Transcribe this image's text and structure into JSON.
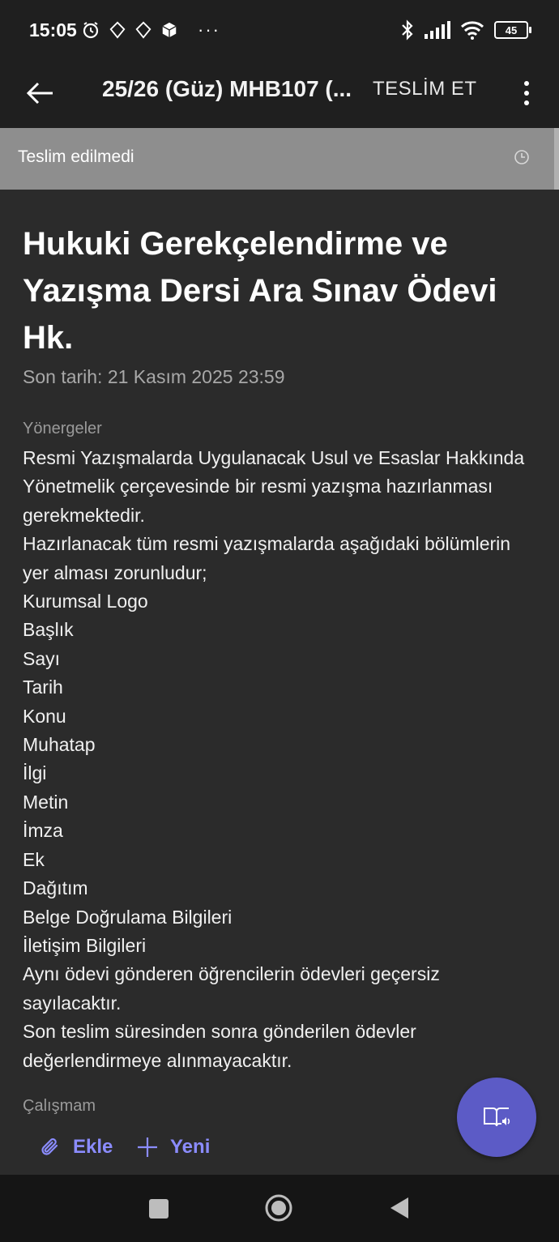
{
  "status_bar": {
    "time": "15:05",
    "battery": "45",
    "more": "···"
  },
  "header": {
    "title": "25/26 (Güz) MHB107 (...",
    "submit_label": "TESLİM ET"
  },
  "submission_status": {
    "label": "Teslim edilmedi"
  },
  "assignment": {
    "title": "Hukuki Gerekçelendirme ve Yazışma Dersi Ara Sınav Ödevi Hk.",
    "due_date": "Son tarih: 21 Kasım 2025 23:59",
    "instructions_label": "Yönergeler",
    "instructions": [
      "Resmi Yazışmalarda Uygulanacak Usul ve Esaslar Hakkında Yönetmelik çerçevesinde bir resmi yazışma hazırlanması gerekmektedir.",
      "Hazırlanacak tüm resmi yazışmalarda aşağıdaki bölümlerin yer alması zorunludur;",
      "Kurumsal Logo",
      "Başlık",
      "Sayı",
      "Tarih",
      "Konu",
      "Muhatap",
      "İlgi",
      "Metin",
      "İmza",
      "Ek",
      "Dağıtım",
      "Belge Doğrulama Bilgileri",
      "İletişim Bilgileri",
      "Aynı ödevi gönderen öğrencilerin ödevleri geçersiz sayılacaktır.",
      "Son teslim süresinden sonra gönderilen ödevler değerlendirmeye alınmayacaktır."
    ],
    "work_label": "Çalışmam",
    "add_label": "Ekle",
    "new_label": "Yeni"
  },
  "colors": {
    "accent": "#8b8cff",
    "fab": "#5c5bc6",
    "status_strip": "#8e8e8e",
    "content_bg": "#2b2b2b"
  },
  "icons": {
    "back": "arrow-left-icon",
    "more": "more-vertical-icon",
    "clock": "clock-icon",
    "attach": "paperclip-icon",
    "new": "plus-icon",
    "immersive_reader": "immersive-reader-icon"
  }
}
